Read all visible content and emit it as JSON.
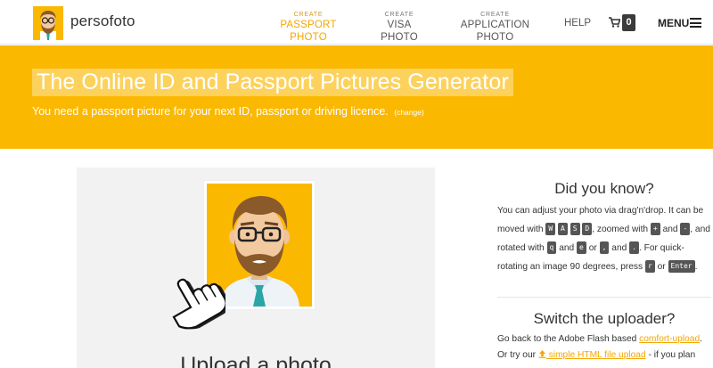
{
  "brand": {
    "name": "persofoto"
  },
  "nav": {
    "passport": {
      "small": "CREATE",
      "label": "PASSPORT PHOTO"
    },
    "visa": {
      "small": "CREATE",
      "label": "VISA PHOTO"
    },
    "application": {
      "small": "CREATE",
      "label": "APPLICATION PHOTO"
    },
    "help": "HELP",
    "cart_count": "0",
    "menu": "MENU"
  },
  "hero": {
    "title": "The Online ID and Passport Pictures Generator",
    "subtitle": "You need a passport picture for your next ID, passport or driving licence.",
    "change_link": "(change)"
  },
  "upload": {
    "title": "Upload a photo"
  },
  "did_you_know": {
    "title": "Did you know?",
    "t1": "You can adjust your photo via drag'n'drop. It can be moved with",
    "k_w": "W",
    "k_a": "A",
    "k_s": "S",
    "k_d": "D",
    "t2": ", zoomed with",
    "k_plus": "+",
    "t3": "and",
    "k_minus": "-",
    "t4": ", and rotated with",
    "k_q": "q",
    "t5": "and",
    "k_e": "e",
    "t6": "or",
    "k_comma": ",",
    "t7": "and",
    "k_dot": ".",
    "t8": ". For quick-rotating an image 90 degrees, press",
    "k_r": "r",
    "t9": "or",
    "k_enter": "Enter",
    "t10": "."
  },
  "switch": {
    "title": "Switch the uploader?",
    "t1": "Go back to the Adobe Flash based",
    "link1": "comfort-upload",
    "t2": ".",
    "t3": "Or try our",
    "link2": "simple HTML file upload",
    "t4": "- if you plan"
  },
  "colors": {
    "accent": "#fbb800",
    "link": "#f5a500",
    "kbd": "#555555"
  },
  "icons": [
    "persofoto-logo-icon",
    "cart-icon",
    "hamburger-menu-icon",
    "avatar-illustration",
    "pointer-hand-icon",
    "upload-icon"
  ]
}
